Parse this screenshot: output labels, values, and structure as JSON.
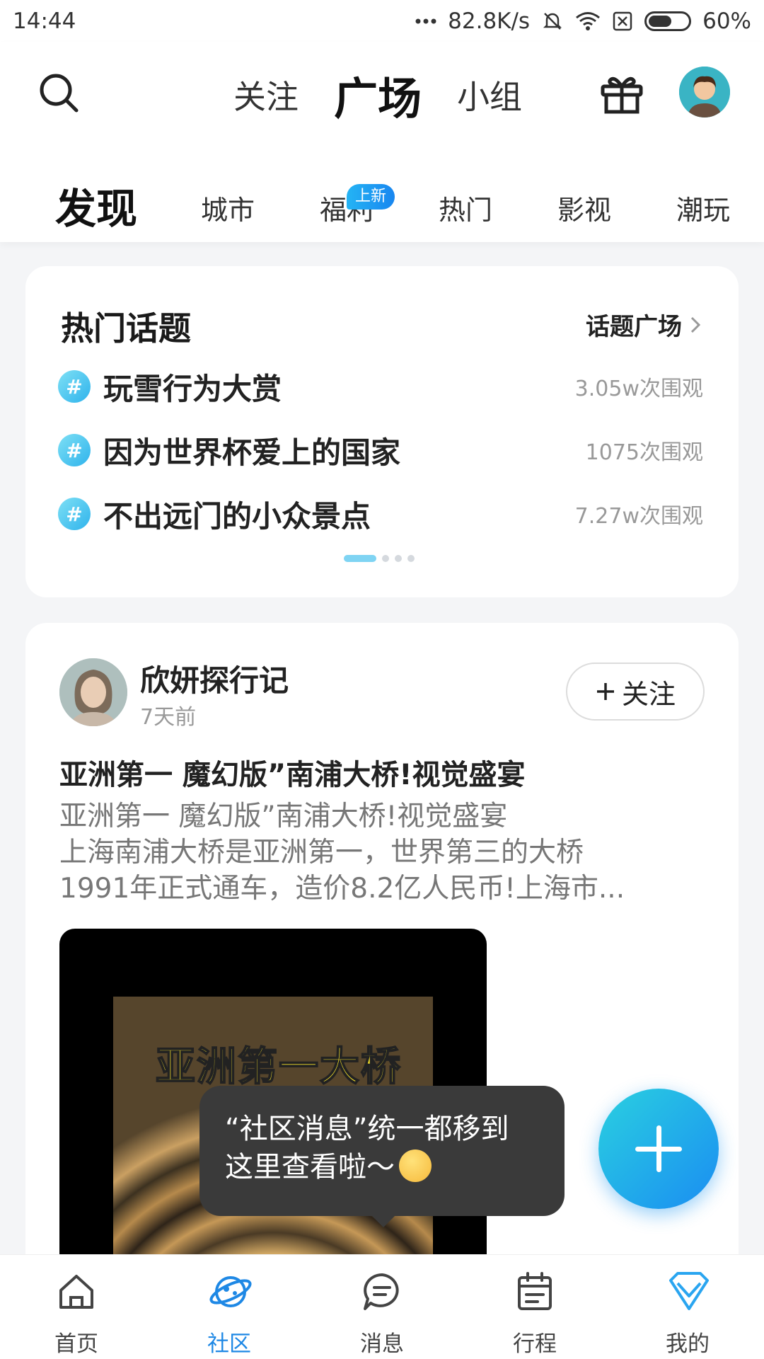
{
  "status_bar": {
    "time": "14:44",
    "net_speed": "82.8K/s",
    "battery": "60%",
    "battery_level": 0.6
  },
  "header": {
    "main_tabs": [
      {
        "label": "关注",
        "active": false
      },
      {
        "label": "广场",
        "active": true
      },
      {
        "label": "小组",
        "active": false
      }
    ],
    "sub_tabs": [
      {
        "label": "发现",
        "active": true
      },
      {
        "label": "城市"
      },
      {
        "label": "福利",
        "badge": "上新"
      },
      {
        "label": "热门"
      },
      {
        "label": "影视"
      },
      {
        "label": "潮玩"
      }
    ]
  },
  "hot_topics": {
    "title": "热门话题",
    "link_label": "话题广场",
    "items": [
      {
        "title": "玩雪行为大赏",
        "views": "3.05w次围观"
      },
      {
        "title": "因为世界杯爱上的国家",
        "views": "1075次围观"
      },
      {
        "title": "不出远门的小众景点",
        "views": "7.27w次围观"
      }
    ]
  },
  "post": {
    "author": "欣妍探行记",
    "time": "7天前",
    "follow_label": "关注",
    "title": "亚洲第一  魔幻版”南浦大桥!视觉盛宴",
    "body": [
      "亚洲第一  魔幻版”南浦大桥!视觉盛宴",
      "上海南浦大桥是亚洲第一，世界第三的大桥",
      "1991年正式通车，造价8.2亿人民币!上海市..."
    ],
    "media_caption": "亚洲第一大桥"
  },
  "tooltip": {
    "line1": "“社区消息”统一都移到",
    "line2": "这里查看啦～"
  },
  "bottom_nav": [
    {
      "label": "首页",
      "icon": "home-icon"
    },
    {
      "label": "社区",
      "icon": "planet-icon",
      "active": true
    },
    {
      "label": "消息",
      "icon": "message-icon"
    },
    {
      "label": "行程",
      "icon": "calendar-icon"
    },
    {
      "label": "我的",
      "icon": "diamond-icon"
    }
  ],
  "colors": {
    "accent": "#1e88e5",
    "accent_teal": "#2fd0c4",
    "badge": "#1886f0"
  }
}
